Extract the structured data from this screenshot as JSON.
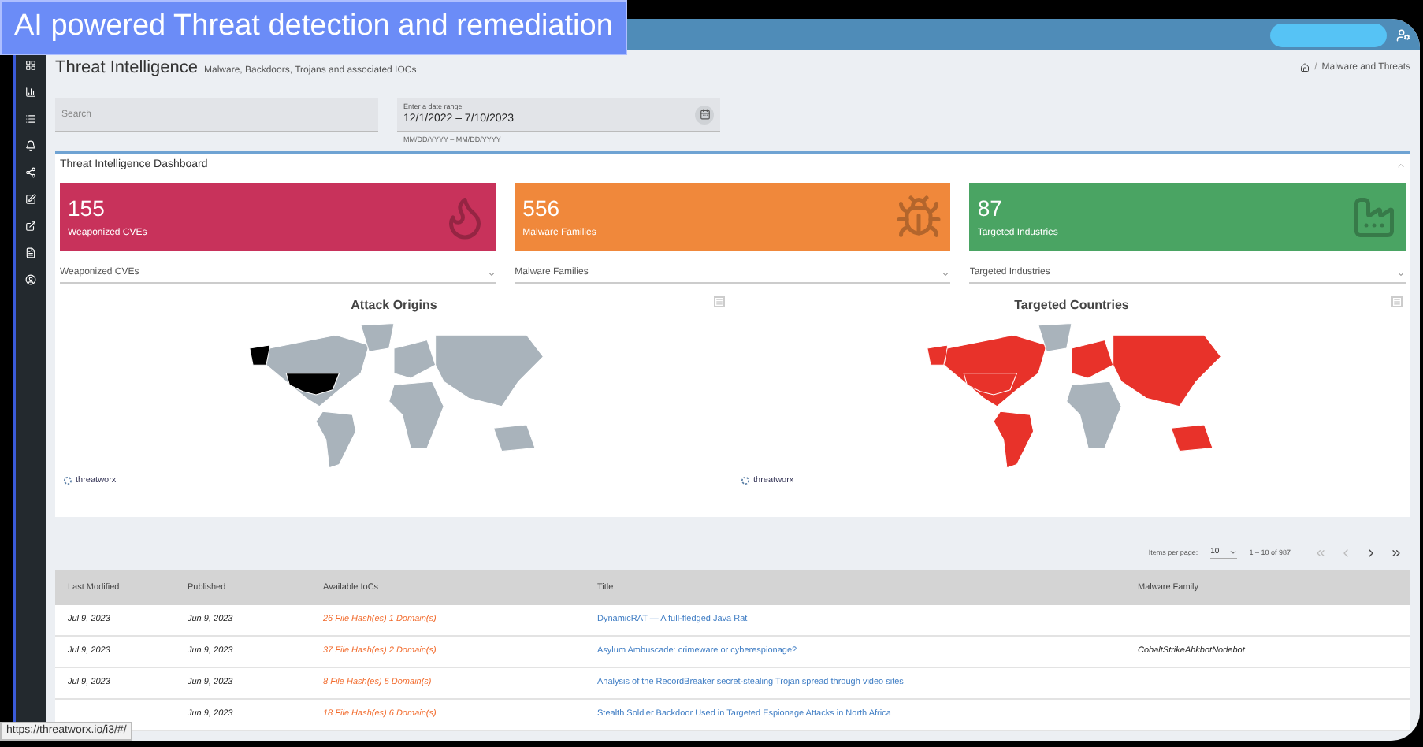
{
  "banner": {
    "text": "AI powered Threat detection and remediation"
  },
  "page": {
    "title": "Threat Intelligence",
    "subtitle": "Malware, Backdoors, Trojans and associated IOCs"
  },
  "breadcrumb": {
    "separator": "/",
    "current": "Malware and Threats"
  },
  "search": {
    "placeholder": "Search"
  },
  "date_range": {
    "label": "Enter a date range",
    "value": "12/1/2022 – 7/10/2023",
    "hint": "MM/DD/YYYY – MM/DD/YYYY"
  },
  "dashboard": {
    "title": "Threat Intelligence Dashboard"
  },
  "cards": [
    {
      "kind": "flame",
      "count": "155",
      "label": "Weaponized CVEs",
      "color": "#c8325b"
    },
    {
      "kind": "bug",
      "count": "556",
      "label": "Malware Families",
      "color": "#f0883b"
    },
    {
      "kind": "factory",
      "count": "87",
      "label": "Targeted Industries",
      "color": "#4aa463"
    }
  ],
  "filters": [
    {
      "value": "Weaponized CVEs"
    },
    {
      "value": "Malware Families"
    },
    {
      "value": "Targeted Industries"
    }
  ],
  "maps": [
    {
      "kind": "origins",
      "title": "Attack Origins",
      "logo": "threatworx"
    },
    {
      "kind": "targets",
      "title": "Targeted Countries",
      "logo": "threatworx"
    }
  ],
  "pagination": {
    "label": "Items per page:",
    "page_size": "10",
    "range": "1 – 10 of 987",
    "nav": [
      {
        "kind": "first",
        "disabled": true
      },
      {
        "kind": "prev",
        "disabled": true
      },
      {
        "kind": "next",
        "disabled": false
      },
      {
        "kind": "last",
        "disabled": false
      }
    ]
  },
  "table": {
    "columns": [
      "Last Modified",
      "Published",
      "Available IoCs",
      "Title",
      "Malware Family"
    ],
    "rows": [
      {
        "last_modified": "Jul 9, 2023",
        "published": "Jun 9, 2023",
        "iocs": "26 File Hash(es) 1 Domain(s)",
        "title": "DynamicRAT — A full-fledged Java Rat",
        "family": ""
      },
      {
        "last_modified": "Jul 9, 2023",
        "published": "Jun 9, 2023",
        "iocs": "37 File Hash(es) 2 Domain(s)",
        "title": "Asylum Ambuscade: crimeware or cyberespionage?",
        "family": "CobaltStrikeAhkbotNodebot"
      },
      {
        "last_modified": "Jul 9, 2023",
        "published": "Jun 9, 2023",
        "iocs": "8 File Hash(es) 5 Domain(s)",
        "title": "Analysis of the RecordBreaker secret-stealing Trojan spread through video sites",
        "family": ""
      },
      {
        "last_modified": "",
        "published": "Jun 9, 2023",
        "iocs": "18 File Hash(es) 6 Domain(s)",
        "title": "Stealth Soldier Backdoor Used in Targeted Espionage Attacks in North Africa",
        "family": ""
      }
    ]
  },
  "status_url": "https://threatworx.io/i3/#/"
}
